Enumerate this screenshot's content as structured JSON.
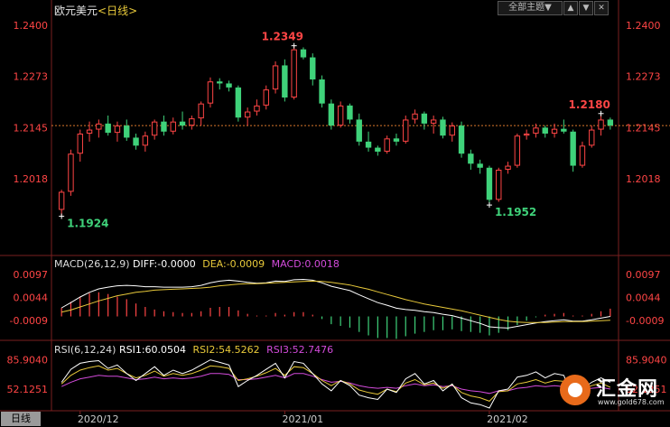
{
  "header": {
    "symbol": "欧元美元",
    "period_label": "<日线>",
    "theme_button": "全部主题",
    "theme_arrow": "▼",
    "btn_up": "▲",
    "btn_down": "▼",
    "btn_close": "✕"
  },
  "badge": "日线",
  "watermark": {
    "text": "汇金网",
    "url": "www.gold678.com"
  },
  "colors": {
    "up": "#ff4545",
    "down": "#3fd27a",
    "macd_diff": "#ffffff",
    "macd_dea": "#e8c93a",
    "macd_macd": "#d34bdb",
    "rsi1": "#ffffff",
    "rsi2": "#e8c93a",
    "rsi3": "#d34bdb",
    "last_line": "#d9782d"
  },
  "chart_data": [
    {
      "type": "candlestick",
      "title": "欧元美元<日线>",
      "y_ticks": [
        "1.2400",
        "1.2273",
        "1.2145",
        "1.2018"
      ],
      "ylim": [
        1.186,
        1.2418
      ],
      "x_tick_labels": [
        "2020/12",
        "2021/01",
        "2021/02"
      ],
      "last_price": 1.215,
      "annotations": [
        {
          "label": "1.1924",
          "value": 1.1924,
          "candle": 0
        },
        {
          "label": "1.2349",
          "value": 1.2349,
          "candle": 25
        },
        {
          "label": "1.1952",
          "value": 1.1952,
          "candle": 46
        },
        {
          "label": "1.2180",
          "value": 1.218,
          "candle": 58
        }
      ],
      "candles": [
        {
          "o": 1.194,
          "h": 1.199,
          "l": 1.1924,
          "c": 1.1985
        },
        {
          "o": 1.1985,
          "h": 1.209,
          "l": 1.1975,
          "c": 1.208
        },
        {
          "o": 1.208,
          "h": 1.214,
          "l": 1.206,
          "c": 1.213
        },
        {
          "o": 1.213,
          "h": 1.216,
          "l": 1.211,
          "c": 1.214
        },
        {
          "o": 1.214,
          "h": 1.2165,
          "l": 1.212,
          "c": 1.2155
        },
        {
          "o": 1.2155,
          "h": 1.2175,
          "l": 1.2125,
          "c": 1.2132
        },
        {
          "o": 1.2132,
          "h": 1.216,
          "l": 1.211,
          "c": 1.215
        },
        {
          "o": 1.215,
          "h": 1.2165,
          "l": 1.2112,
          "c": 1.212
        },
        {
          "o": 1.212,
          "h": 1.213,
          "l": 1.209,
          "c": 1.21
        },
        {
          "o": 1.21,
          "h": 1.2135,
          "l": 1.2085,
          "c": 1.2125
        },
        {
          "o": 1.2125,
          "h": 1.2165,
          "l": 1.2115,
          "c": 1.216
        },
        {
          "o": 1.216,
          "h": 1.2175,
          "l": 1.2125,
          "c": 1.2135
        },
        {
          "o": 1.2135,
          "h": 1.217,
          "l": 1.2128,
          "c": 1.216
        },
        {
          "o": 1.216,
          "h": 1.2185,
          "l": 1.214,
          "c": 1.215
        },
        {
          "o": 1.215,
          "h": 1.2175,
          "l": 1.214,
          "c": 1.2168
        },
        {
          "o": 1.2168,
          "h": 1.221,
          "l": 1.215,
          "c": 1.2205
        },
        {
          "o": 1.2205,
          "h": 1.227,
          "l": 1.2195,
          "c": 1.226
        },
        {
          "o": 1.226,
          "h": 1.2268,
          "l": 1.224,
          "c": 1.2255
        },
        {
          "o": 1.2255,
          "h": 1.2262,
          "l": 1.2235,
          "c": 1.2245
        },
        {
          "o": 1.2245,
          "h": 1.225,
          "l": 1.216,
          "c": 1.217
        },
        {
          "o": 1.217,
          "h": 1.2195,
          "l": 1.215,
          "c": 1.2185
        },
        {
          "o": 1.2185,
          "h": 1.2215,
          "l": 1.2175,
          "c": 1.22
        },
        {
          "o": 1.22,
          "h": 1.225,
          "l": 1.219,
          "c": 1.224
        },
        {
          "o": 1.224,
          "h": 1.231,
          "l": 1.223,
          "c": 1.23
        },
        {
          "o": 1.23,
          "h": 1.2315,
          "l": 1.221,
          "c": 1.222
        },
        {
          "o": 1.222,
          "h": 1.2349,
          "l": 1.2215,
          "c": 1.234
        },
        {
          "o": 1.234,
          "h": 1.2345,
          "l": 1.2315,
          "c": 1.232
        },
        {
          "o": 1.232,
          "h": 1.233,
          "l": 1.225,
          "c": 1.2265
        },
        {
          "o": 1.2265,
          "h": 1.2275,
          "l": 1.2195,
          "c": 1.2205
        },
        {
          "o": 1.2205,
          "h": 1.2215,
          "l": 1.214,
          "c": 1.215
        },
        {
          "o": 1.215,
          "h": 1.221,
          "l": 1.2145,
          "c": 1.22
        },
        {
          "o": 1.22,
          "h": 1.2205,
          "l": 1.2155,
          "c": 1.2165
        },
        {
          "o": 1.2165,
          "h": 1.218,
          "l": 1.21,
          "c": 1.211
        },
        {
          "o": 1.211,
          "h": 1.2135,
          "l": 1.2085,
          "c": 1.2095
        },
        {
          "o": 1.2095,
          "h": 1.21,
          "l": 1.2075,
          "c": 1.2085
        },
        {
          "o": 1.2085,
          "h": 1.2125,
          "l": 1.208,
          "c": 1.2118
        },
        {
          "o": 1.2118,
          "h": 1.213,
          "l": 1.21,
          "c": 1.211
        },
        {
          "o": 1.211,
          "h": 1.2175,
          "l": 1.2105,
          "c": 1.2165
        },
        {
          "o": 1.2165,
          "h": 1.219,
          "l": 1.2155,
          "c": 1.218
        },
        {
          "o": 1.218,
          "h": 1.2185,
          "l": 1.214,
          "c": 1.2155
        },
        {
          "o": 1.2155,
          "h": 1.2175,
          "l": 1.213,
          "c": 1.2165
        },
        {
          "o": 1.2165,
          "h": 1.2172,
          "l": 1.2118,
          "c": 1.2125
        },
        {
          "o": 1.2125,
          "h": 1.2158,
          "l": 1.211,
          "c": 1.215
        },
        {
          "o": 1.215,
          "h": 1.216,
          "l": 1.207,
          "c": 1.208
        },
        {
          "o": 1.208,
          "h": 1.209,
          "l": 1.204,
          "c": 1.2055
        },
        {
          "o": 1.2055,
          "h": 1.2065,
          "l": 1.203,
          "c": 1.2045
        },
        {
          "o": 1.2045,
          "h": 1.205,
          "l": 1.1952,
          "c": 1.1965
        },
        {
          "o": 1.1965,
          "h": 1.2045,
          "l": 1.196,
          "c": 1.204
        },
        {
          "o": 1.204,
          "h": 1.206,
          "l": 1.203,
          "c": 1.205
        },
        {
          "o": 1.205,
          "h": 1.213,
          "l": 1.2045,
          "c": 1.2125
        },
        {
          "o": 1.2125,
          "h": 1.214,
          "l": 1.2115,
          "c": 1.213
        },
        {
          "o": 1.213,
          "h": 1.2155,
          "l": 1.212,
          "c": 1.2145
        },
        {
          "o": 1.2145,
          "h": 1.215,
          "l": 1.212,
          "c": 1.213
        },
        {
          "o": 1.213,
          "h": 1.2155,
          "l": 1.212,
          "c": 1.2142
        },
        {
          "o": 1.2142,
          "h": 1.2165,
          "l": 1.213,
          "c": 1.2135
        },
        {
          "o": 1.2135,
          "h": 1.214,
          "l": 1.2035,
          "c": 1.205
        },
        {
          "o": 1.205,
          "h": 1.211,
          "l": 1.2045,
          "c": 1.21
        },
        {
          "o": 1.21,
          "h": 1.215,
          "l": 1.2095,
          "c": 1.214
        },
        {
          "o": 1.214,
          "h": 1.218,
          "l": 1.2125,
          "c": 1.2165
        },
        {
          "o": 1.2165,
          "h": 1.217,
          "l": 1.214,
          "c": 1.215
        }
      ]
    },
    {
      "type": "bar+line",
      "title": "MACD(26,12,9)",
      "legend": [
        {
          "name": "DIFF:-0.0000",
          "color": "#ffffff"
        },
        {
          "name": "DEA:-0.0009",
          "color": "#e8c93a"
        },
        {
          "name": "MACD:0.0018",
          "color": "#d34bdb"
        }
      ],
      "y_ticks": [
        "0.0097",
        "0.0044",
        "-0.0009"
      ],
      "ylim": [
        -0.0045,
        0.011
      ],
      "diff": [
        0.002,
        0.0032,
        0.0045,
        0.0056,
        0.0064,
        0.0068,
        0.0071,
        0.0072,
        0.0071,
        0.0069,
        0.0069,
        0.0068,
        0.0068,
        0.0068,
        0.0069,
        0.0072,
        0.0078,
        0.0082,
        0.0084,
        0.0082,
        0.0079,
        0.0077,
        0.0078,
        0.0082,
        0.0081,
        0.0085,
        0.0086,
        0.0084,
        0.0078,
        0.007,
        0.0065,
        0.006,
        0.005,
        0.0041,
        0.0032,
        0.0026,
        0.0019,
        0.0016,
        0.0014,
        0.0011,
        0.0009,
        0.0005,
        0.0002,
        -0.0004,
        -0.001,
        -0.0016,
        -0.0024,
        -0.0026,
        -0.0027,
        -0.0023,
        -0.0019,
        -0.0015,
        -0.0012,
        -0.001,
        -0.0008,
        -0.0011,
        -0.0011,
        -0.0008,
        -0.0004,
        -0.0
      ],
      "dea": [
        0.001,
        0.0015,
        0.0022,
        0.0029,
        0.0036,
        0.0042,
        0.0048,
        0.0052,
        0.0056,
        0.0058,
        0.0061,
        0.0062,
        0.0063,
        0.0064,
        0.0065,
        0.0066,
        0.0068,
        0.0071,
        0.0073,
        0.0075,
        0.0076,
        0.0076,
        0.0077,
        0.0078,
        0.0079,
        0.008,
        0.0081,
        0.0082,
        0.0081,
        0.0079,
        0.0076,
        0.0073,
        0.0068,
        0.0063,
        0.0057,
        0.0051,
        0.0045,
        0.0039,
        0.0034,
        0.0029,
        0.0025,
        0.0021,
        0.0017,
        0.0013,
        0.0008,
        0.0003,
        -0.0002,
        -0.0007,
        -0.0011,
        -0.0013,
        -0.0014,
        -0.0014,
        -0.0014,
        -0.0013,
        -0.0012,
        -0.0012,
        -0.0012,
        -0.0011,
        -0.001,
        -0.0009
      ],
      "macd": [
        0.002,
        0.0034,
        0.0046,
        0.0054,
        0.0056,
        0.0052,
        0.0046,
        0.004,
        0.003,
        0.0022,
        0.0016,
        0.0012,
        0.001,
        0.0008,
        0.0008,
        0.0012,
        0.002,
        0.0022,
        0.0022,
        0.0014,
        0.0006,
        0.0002,
        0.0002,
        0.0008,
        0.0004,
        0.001,
        0.001,
        0.0004,
        -0.0006,
        -0.0018,
        -0.0022,
        -0.0026,
        -0.0036,
        -0.0044,
        -0.005,
        -0.005,
        -0.0052,
        -0.0046,
        -0.004,
        -0.0036,
        -0.0032,
        -0.0032,
        -0.003,
        -0.0034,
        -0.0036,
        -0.0038,
        -0.0044,
        -0.0038,
        -0.0032,
        -0.002,
        -0.001,
        -0.0002,
        0.0004,
        0.0006,
        0.0008,
        0.0002,
        0.0002,
        0.0006,
        0.0012,
        0.0018
      ]
    },
    {
      "type": "line",
      "title": "RSI(6,12,24)",
      "legend": [
        {
          "name": "RSI1:60.0504",
          "color": "#ffffff"
        },
        {
          "name": "RSI2:54.5262",
          "color": "#e8c93a"
        },
        {
          "name": "RSI3:52.7476",
          "color": "#d34bdb"
        }
      ],
      "y_ticks": [
        "85.9040",
        "52.1251"
      ],
      "ylim": [
        30,
        95
      ],
      "rsi1": [
        60,
        75,
        82,
        84,
        85,
        76,
        80,
        70,
        62,
        70,
        78,
        68,
        74,
        70,
        74,
        80,
        86,
        83,
        80,
        55,
        62,
        68,
        75,
        82,
        65,
        84,
        82,
        70,
        58,
        50,
        62,
        56,
        45,
        42,
        40,
        52,
        48,
        64,
        70,
        58,
        62,
        50,
        58,
        42,
        36,
        34,
        30,
        50,
        52,
        66,
        68,
        72,
        65,
        70,
        68,
        40,
        52,
        60,
        65,
        60
      ],
      "rsi2": [
        58,
        68,
        74,
        77,
        79,
        74,
        76,
        70,
        65,
        68,
        73,
        67,
        70,
        68,
        70,
        74,
        79,
        78,
        76,
        62,
        64,
        67,
        71,
        76,
        68,
        78,
        77,
        70,
        62,
        56,
        62,
        58,
        51,
        48,
        46,
        52,
        49,
        59,
        63,
        57,
        59,
        53,
        57,
        48,
        44,
        42,
        38,
        49,
        50,
        58,
        60,
        63,
        59,
        62,
        61,
        47,
        53,
        56,
        59,
        54
      ],
      "rsi3": [
        55,
        60,
        64,
        66,
        68,
        67,
        67,
        65,
        63,
        64,
        66,
        64,
        65,
        64,
        65,
        67,
        70,
        70,
        69,
        63,
        63,
        64,
        66,
        68,
        65,
        70,
        70,
        67,
        63,
        60,
        61,
        59,
        56,
        54,
        53,
        54,
        53,
        56,
        58,
        56,
        57,
        55,
        56,
        52,
        50,
        49,
        47,
        50,
        50,
        53,
        54,
        56,
        55,
        56,
        55,
        51,
        52,
        53,
        54,
        52
      ]
    }
  ]
}
